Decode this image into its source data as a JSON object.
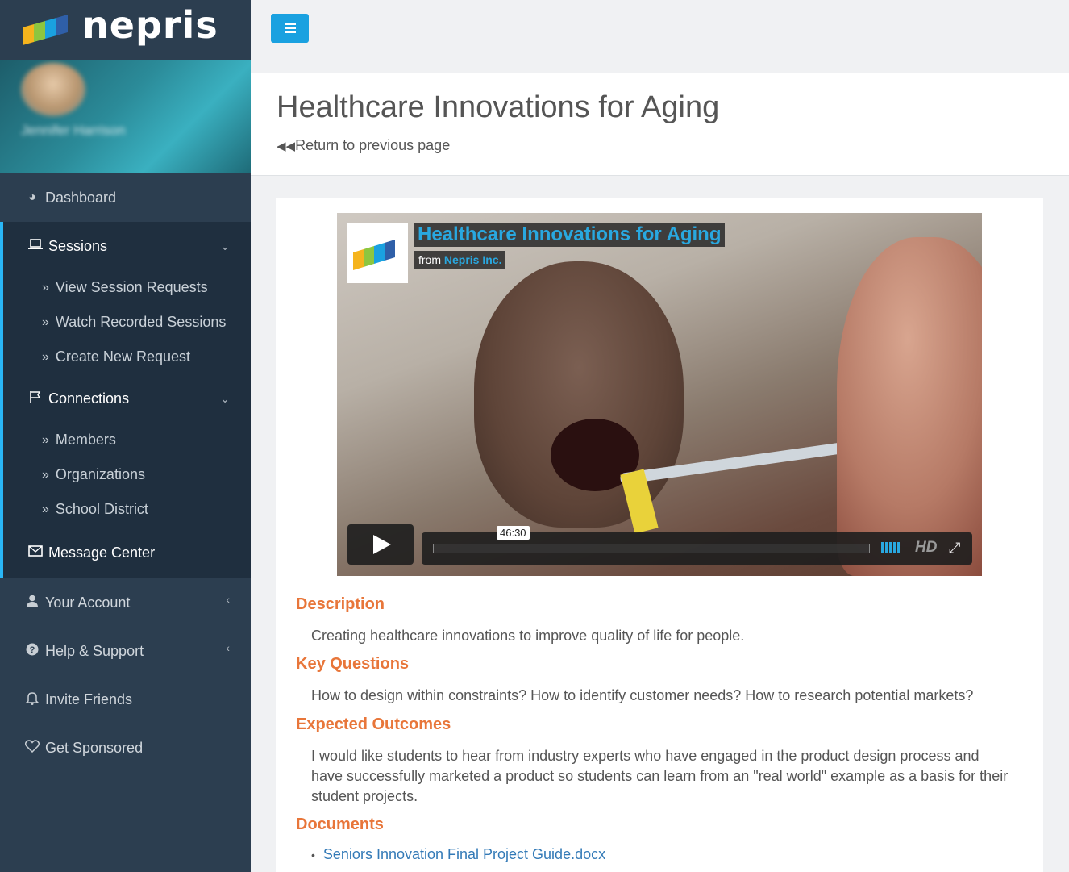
{
  "brand": {
    "name": "nepris"
  },
  "profile": {
    "name": "Jennifer Harrison"
  },
  "sidebar": {
    "items": [
      {
        "label": "Dashboard",
        "icon": "dashboard-icon"
      },
      {
        "label": "Sessions",
        "icon": "laptop-icon"
      },
      {
        "label": "View Session Requests"
      },
      {
        "label": "Watch Recorded Sessions"
      },
      {
        "label": "Create New Request"
      },
      {
        "label": "Connections",
        "icon": "flag-icon"
      },
      {
        "label": "Members"
      },
      {
        "label": "Organizations"
      },
      {
        "label": "School District"
      },
      {
        "label": "Message Center",
        "icon": "envelope-icon"
      },
      {
        "label": "Your Account",
        "icon": "user-icon"
      },
      {
        "label": "Help & Support",
        "icon": "question-icon"
      },
      {
        "label": "Invite Friends",
        "icon": "bell-icon"
      },
      {
        "label": "Get Sponsored",
        "icon": "heart-icon"
      }
    ]
  },
  "page": {
    "title": "Healthcare Innovations for Aging",
    "back_label": "Return to previous page"
  },
  "video": {
    "title": "Healthcare Innovations for Aging",
    "from_prefix": "from",
    "from_org": "Nepris Inc.",
    "duration": "46:30",
    "hd_label": "HD"
  },
  "sections": {
    "description_heading": "Description",
    "description_text": "Creating healthcare innovations to improve quality of life for people.",
    "key_questions_heading": "Key Questions",
    "key_questions_text": "How to design within constraints?  How to identify customer needs?  How to research potential markets?",
    "outcomes_heading": "Expected Outcomes",
    "outcomes_text": "I would like students to hear from industry experts who have engaged in the product design process and have successfully marketed a product so students can learn from an \"real world\" example as a basis for their student projects.",
    "documents_heading": "Documents",
    "documents": [
      "Seniors Innovation Final Project Guide.docx"
    ]
  },
  "colors": {
    "sidebar_bg": "#2c3e50",
    "accent": "#29b6f6",
    "menu_button": "#1aa1e0",
    "heading_orange": "#e8763a",
    "link_blue": "#337ab7"
  }
}
